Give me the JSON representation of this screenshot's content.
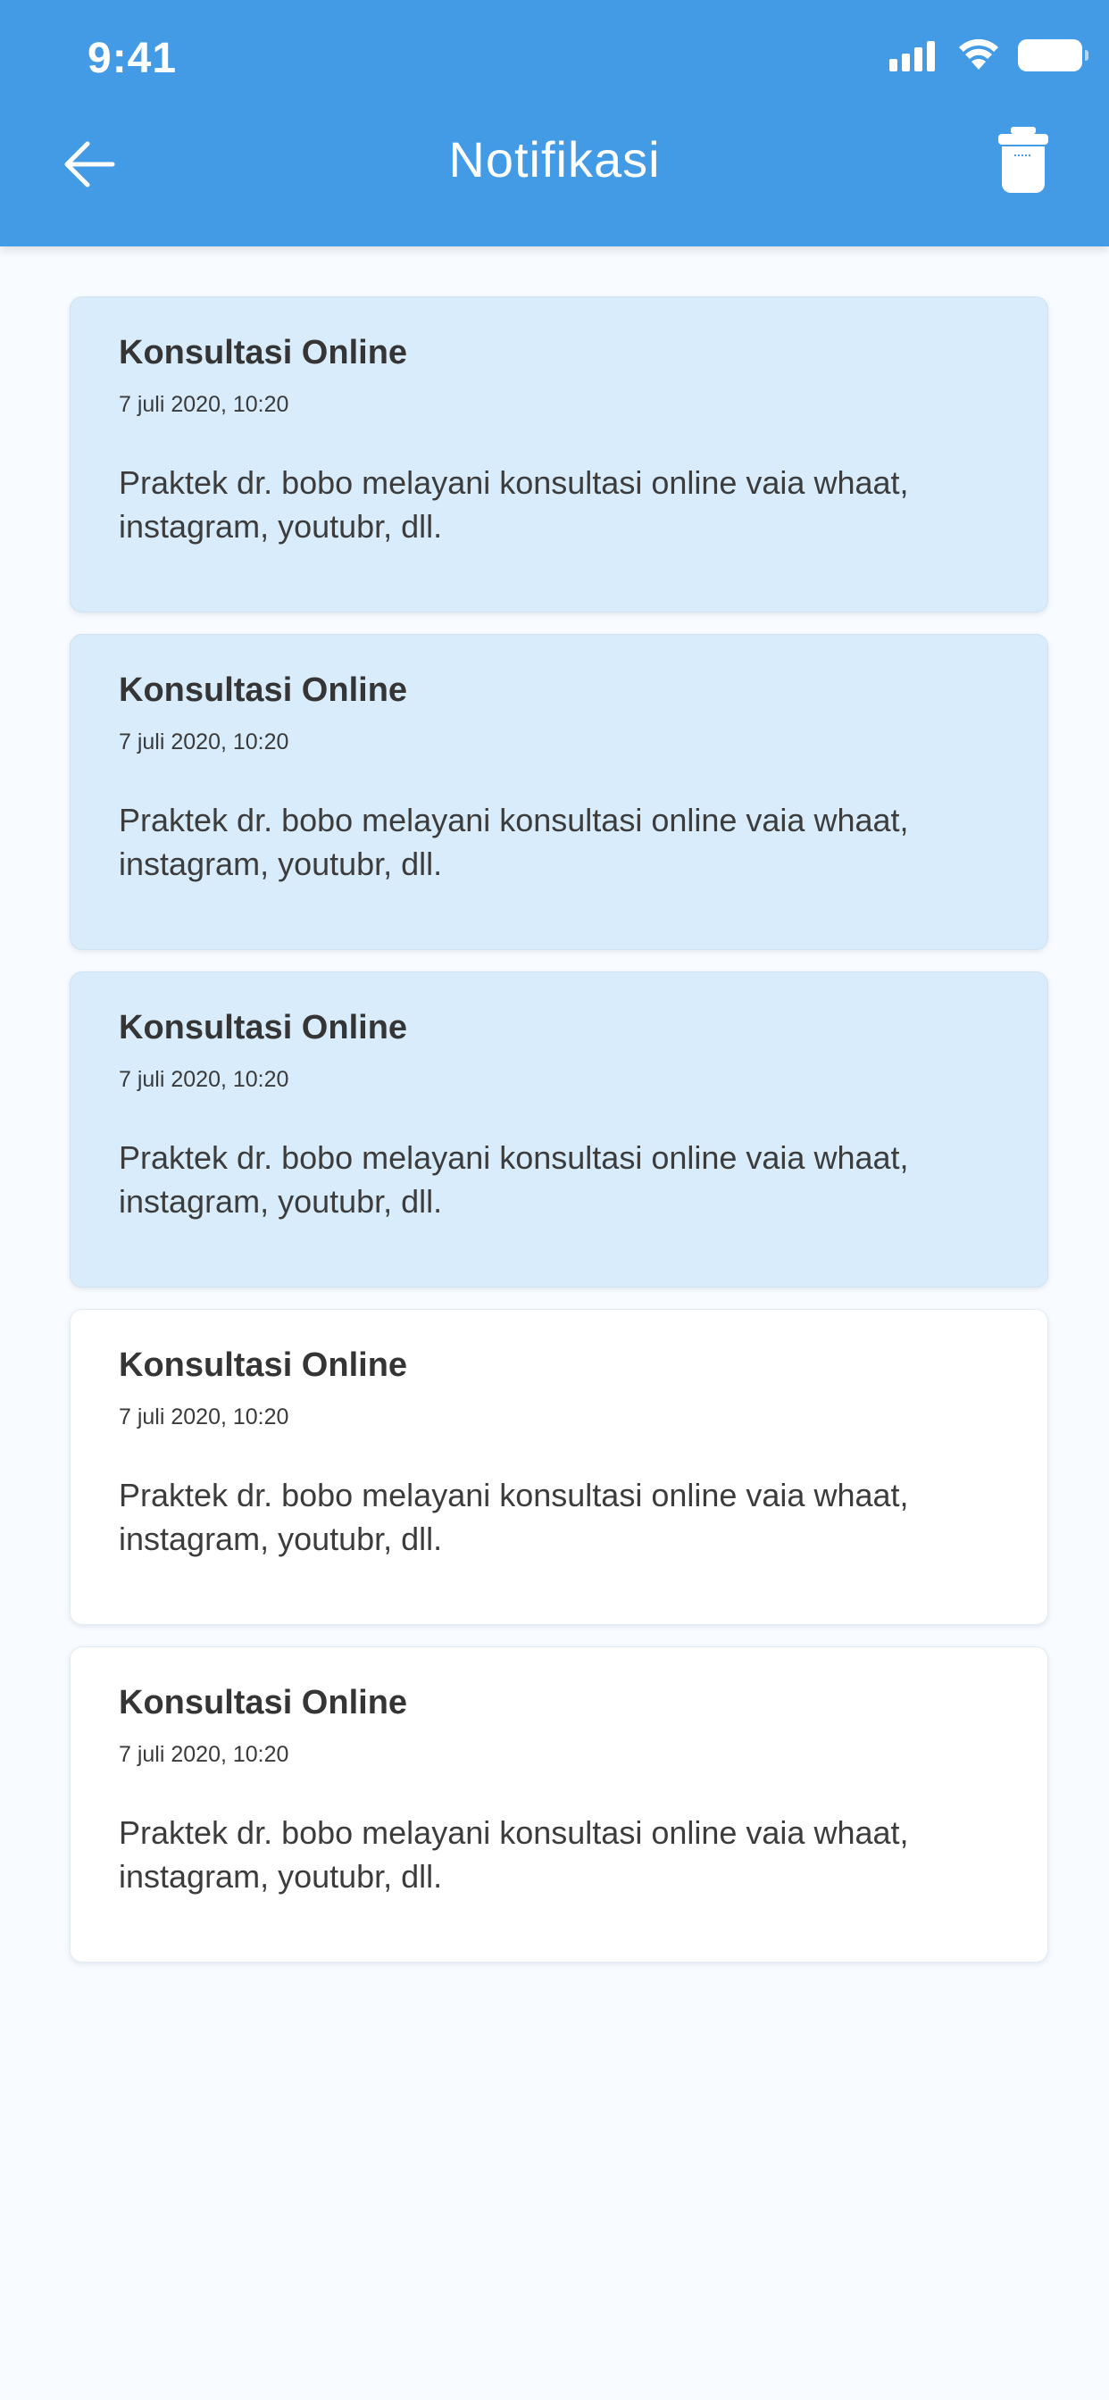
{
  "status_bar": {
    "time": "9:41"
  },
  "header": {
    "title": "Notifikasi",
    "back_icon": "arrow-left-icon",
    "delete_icon": "trash-icon"
  },
  "colors": {
    "header_bg": "#439be5",
    "unread_card_bg": "#d8ecfb",
    "read_card_bg": "#ffffff",
    "page_bg": "#f8fbff"
  },
  "notifications": [
    {
      "title": "Konsultasi Online",
      "time": "7 juli 2020, 10:20",
      "body": "Praktek dr. bobo melayani konsultasi online vaia whaat, instagram, youtubr, dll.",
      "unread": true
    },
    {
      "title": "Konsultasi Online",
      "time": "7 juli 2020, 10:20",
      "body": "Praktek dr. bobo melayani konsultasi online vaia whaat, instagram, youtubr, dll.",
      "unread": true
    },
    {
      "title": "Konsultasi Online",
      "time": "7 juli 2020, 10:20",
      "body": "Praktek dr. bobo melayani konsultasi online vaia whaat, instagram, youtubr, dll.",
      "unread": true
    },
    {
      "title": "Konsultasi Online",
      "time": "7 juli 2020, 10:20",
      "body": "Praktek dr. bobo melayani konsultasi online vaia whaat, instagram, youtubr, dll.",
      "unread": false
    },
    {
      "title": "Konsultasi Online",
      "time": "7 juli 2020, 10:20",
      "body": "Praktek dr. bobo melayani konsultasi online vaia whaat, instagram, youtubr, dll.",
      "unread": false
    }
  ]
}
